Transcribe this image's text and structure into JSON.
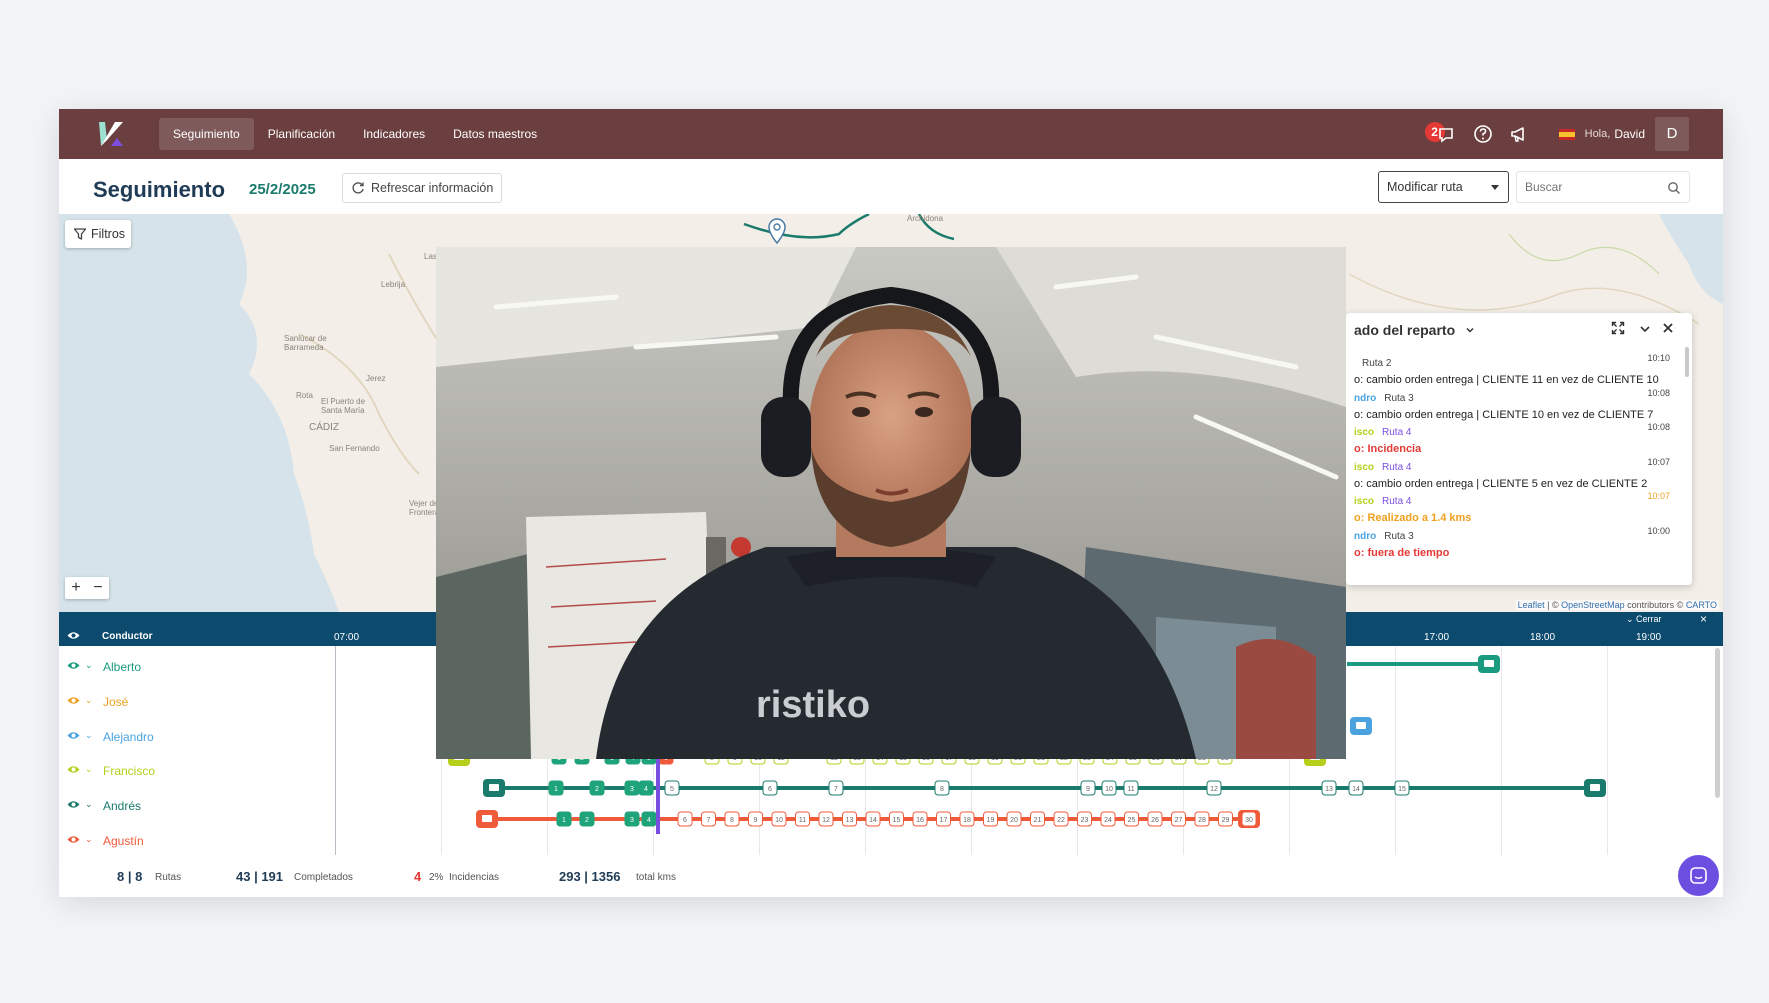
{
  "nav": {
    "items": [
      {
        "label": "Seguimiento",
        "active": true
      },
      {
        "label": "Planificación",
        "active": false
      },
      {
        "label": "Indicadores",
        "active": false
      },
      {
        "label": "Datos maestros",
        "active": false
      }
    ],
    "notification_count": "2",
    "greeting": "Hola,",
    "user_name": "David",
    "avatar_initial": "D"
  },
  "header": {
    "title": "Seguimiento",
    "date": "25/2/2025",
    "refresh_label": "Refrescar información",
    "route_select": "Modificar ruta",
    "search_placeholder": "Buscar"
  },
  "map": {
    "filters_label": "Filtros",
    "zoom_in": "+",
    "zoom_out": "−",
    "labels": [
      "Archidona",
      "Las Cabezas",
      "Lebrija",
      "Sanlúcar de Barrameda",
      "Jerez",
      "Rota",
      "El Puerto de Santa María",
      "CÁDIZ",
      "San Fernando",
      "Vejer de la Frontera"
    ],
    "attribution": {
      "leaflet": "Leaflet",
      "sep": " | © ",
      "osm": "OpenStreetMap",
      "mid": " contributors © ",
      "carto": "CARTO"
    }
  },
  "events": {
    "title_visible": "ado del reparto",
    "items": [
      {
        "driver": "",
        "route": "Ruta 2",
        "time": "10:10",
        "msg": "o: cambio orden entrega | CLIENTE 11 en vez de CLIENTE 10",
        "driver_color": "#1a7a6c",
        "msg_color": "#222222"
      },
      {
        "driver": "ndro",
        "route": "Ruta 3",
        "time": "10:08",
        "msg": "o: cambio orden entrega | CLIENTE 10 en vez de CLIENTE 7",
        "driver_color": "#4aa3df",
        "msg_color": "#222222"
      },
      {
        "driver": "isco",
        "route": "Ruta 4",
        "time": "10:08",
        "msg": "o: Incidencia",
        "driver_color": "#b5cf1a",
        "msg_color": "#e53935"
      },
      {
        "driver": "isco",
        "route": "Ruta 4",
        "time": "10:07",
        "msg": "o: cambio orden entrega | CLIENTE 5 en vez de CLIENTE 2",
        "driver_color": "#b5cf1a",
        "msg_color": "#222222"
      },
      {
        "driver": "isco",
        "route": "Ruta 4",
        "time": "10:07",
        "msg": "o: Realizado a 1.4 kms",
        "driver_color": "#b5cf1a",
        "msg_color": "#f0a020"
      },
      {
        "driver": "ndro",
        "route": "Ruta 3",
        "time": "10:00",
        "msg": "o: fuera de tiempo",
        "driver_color": "#4aa3df",
        "msg_color": "#e53935"
      }
    ]
  },
  "timeline": {
    "conductor_label": "Conductor",
    "hours": [
      "07:00",
      "17:00",
      "18:00",
      "19:00"
    ],
    "cerrar": "Cerrar",
    "close": "×",
    "drivers": [
      {
        "name": "Alberto",
        "color": "#1a9a7f"
      },
      {
        "name": "José",
        "color": "#f0a020"
      },
      {
        "name": "Alejandro",
        "color": "#4aa3df"
      },
      {
        "name": "Francisco",
        "color": "#b5cf1a"
      },
      {
        "name": "Andrés",
        "color": "#1a7a6c"
      },
      {
        "name": "Agustín",
        "color": "#ef5a3a"
      }
    ],
    "francisco_done": [
      "1",
      "2",
      "3",
      "4",
      "5"
    ],
    "francisco_current": "6",
    "francisco_pending": [
      "8",
      "9",
      "10",
      "11",
      "12",
      "13",
      "14",
      "15",
      "16",
      "17",
      "18",
      "19",
      "20",
      "21",
      "22",
      "23",
      "24",
      "25",
      "26",
      "27",
      "28",
      "29"
    ],
    "andres_done": [
      "1",
      "2",
      "3",
      "4"
    ],
    "andres_pending": [
      "5",
      "6",
      "7",
      "8",
      "9",
      "10",
      "11",
      "12",
      "13",
      "14",
      "15"
    ],
    "agustin_done": [
      "1",
      "2",
      "3",
      "4"
    ],
    "agustin_pending": [
      "6",
      "7",
      "8",
      "9",
      "10",
      "11",
      "12",
      "13",
      "14",
      "15",
      "16",
      "17",
      "18",
      "19",
      "20",
      "21",
      "22",
      "23",
      "24",
      "25",
      "26",
      "27",
      "28",
      "29",
      "30"
    ]
  },
  "footer": {
    "routes": "8 | 8",
    "routes_label": "Rutas",
    "completed": "43 | 191",
    "completed_label": "Completados",
    "incidents": "4",
    "incidents_pct": "2%",
    "incidents_label": "Incidencias",
    "kms": "293 | 1356",
    "kms_label": "total kms"
  },
  "video": {
    "hoodie_text": "ristiko"
  }
}
